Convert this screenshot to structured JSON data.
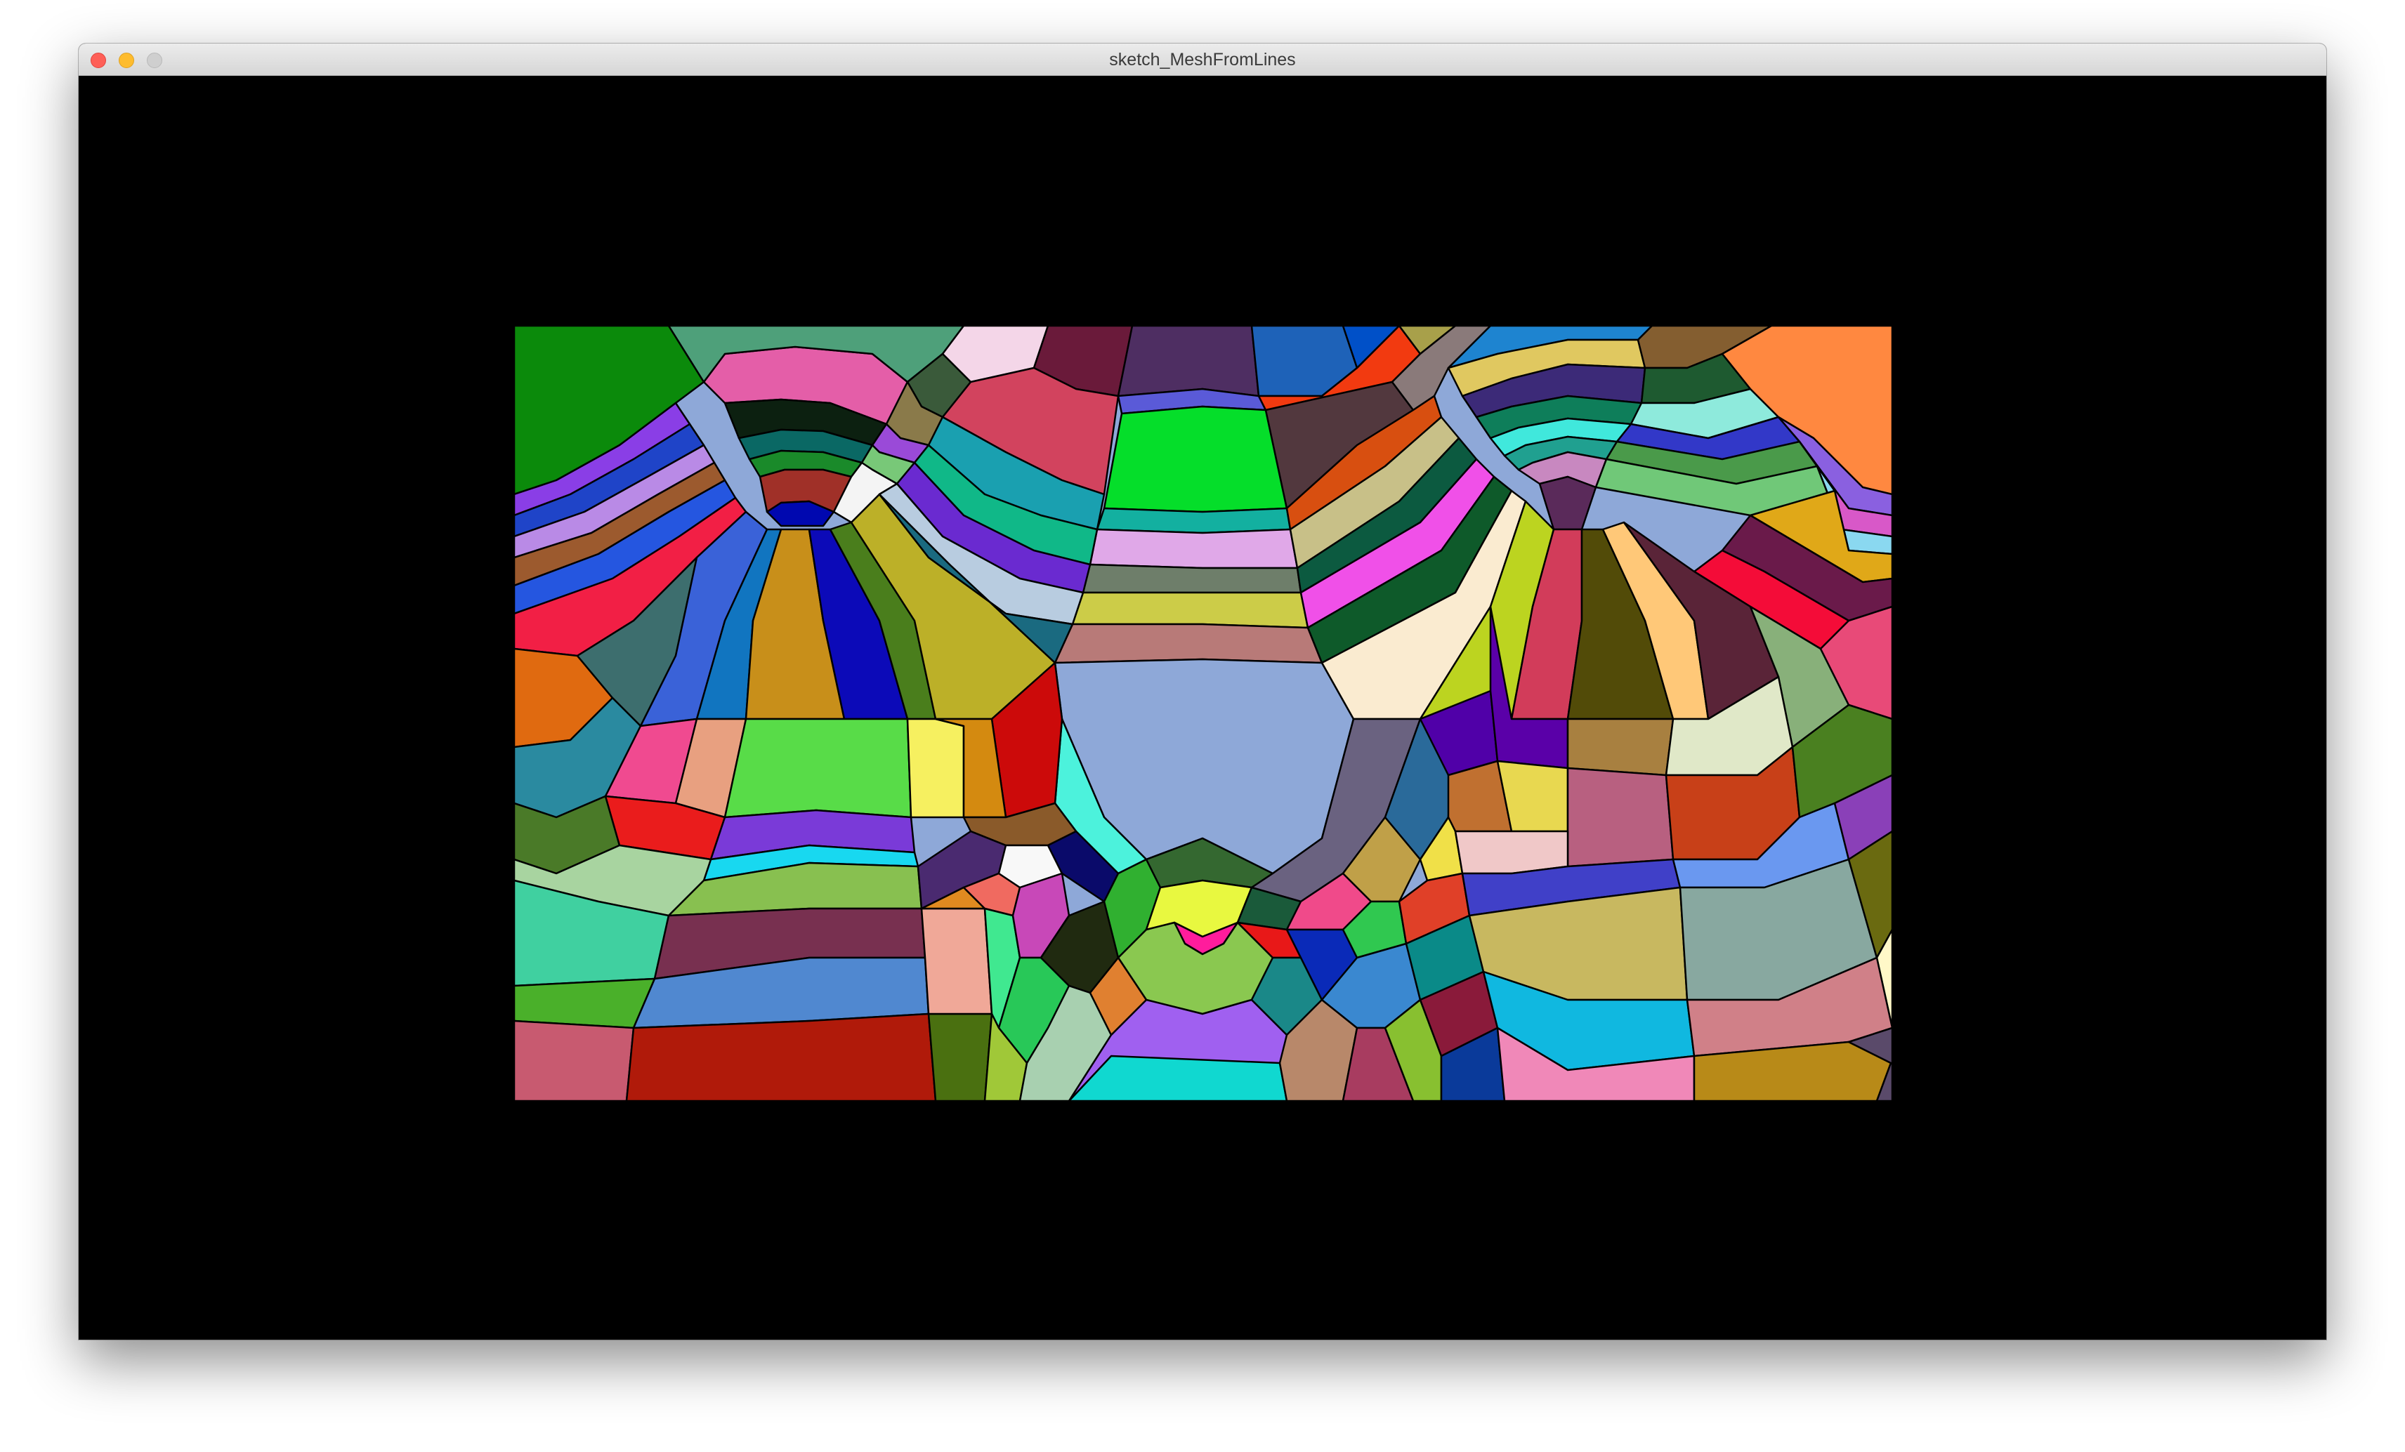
{
  "window": {
    "title": "sketch_MeshFromLines"
  },
  "colors": {
    "background": "#000000",
    "titlebar": "#e3e3e3",
    "close": "#fe5f57",
    "minimize": "#febc2e",
    "zoom": "#cfcfcf",
    "mesh_stroke": "#000000"
  },
  "icons": {
    "close": "close-icon",
    "minimize": "minimize-icon",
    "zoom": "zoom-icon"
  }
}
